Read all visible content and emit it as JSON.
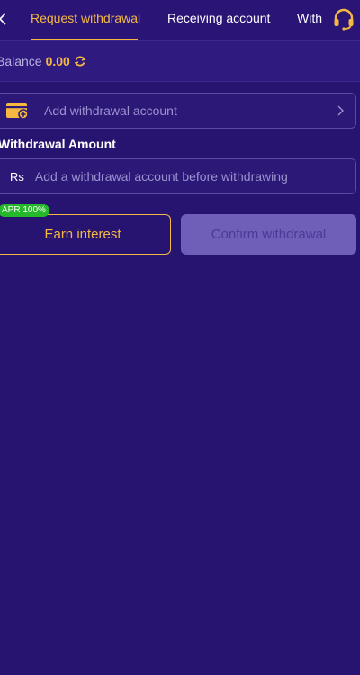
{
  "nav": {
    "tabs": [
      {
        "label": "Request withdrawal",
        "active": true
      },
      {
        "label": "Receiving account",
        "active": false
      },
      {
        "label": "With",
        "active": false
      }
    ]
  },
  "balance": {
    "label": "Balance",
    "value": "0.00"
  },
  "add_account": {
    "label": "Add withdrawal account"
  },
  "amount": {
    "label": "Withdrawal Amount",
    "currency": "Rs",
    "placeholder": "Add a withdrawal account before withdrawing"
  },
  "actions": {
    "apr_badge": "APR 100%",
    "earn_label": "Earn interest",
    "confirm_label": "Confirm withdrawal"
  },
  "colors": {
    "background": "#271370",
    "accent": "#f5b942",
    "badge": "#25b82a",
    "disabled_button": "#6f5fb8"
  },
  "icons": [
    "back-arrow-icon",
    "headset-icon",
    "refresh-icon",
    "wallet-add-icon",
    "chevron-right-icon"
  ]
}
